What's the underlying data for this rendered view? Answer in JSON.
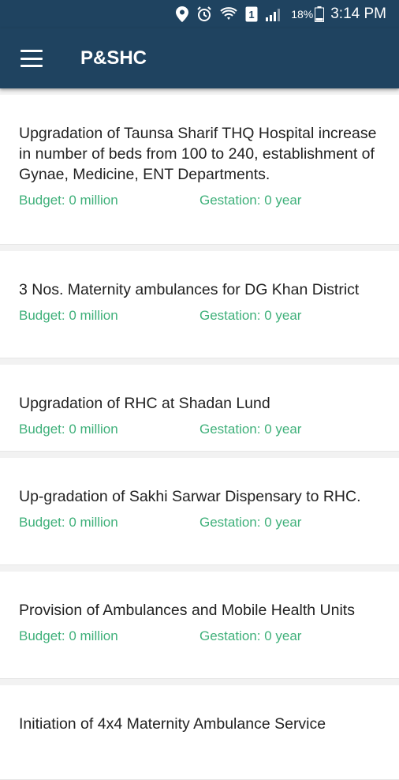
{
  "status_bar": {
    "battery_percent": "18%",
    "time": "3:14 PM",
    "sim_label": "1",
    "icons": [
      "location-icon",
      "alarm-icon",
      "wifi-icon",
      "sim-icon",
      "signal-icon",
      "battery-icon"
    ]
  },
  "app_bar": {
    "title": "P&SHC",
    "menu_icon": "hamburger-menu-icon"
  },
  "projects": [
    {
      "title": "Upgradation of Taunsa Sharif THQ Hospital increase in number of beds from 100 to 240, establishment of Gynae, Medicine, ENT Departments.",
      "budget": "Budget: 0 million",
      "gestation": "Gestation: 0 year"
    },
    {
      "title": "3 Nos. Maternity ambulances for DG Khan District",
      "budget": "Budget: 0 million",
      "gestation": "Gestation: 0 year"
    },
    {
      "title": "Upgradation of RHC at Shadan Lund",
      "budget": "Budget: 0 million",
      "gestation": "Gestation: 0 year"
    },
    {
      "title": "Up-gradation of Sakhi Sarwar Dispensary to RHC.",
      "budget": "Budget: 0 million",
      "gestation": "Gestation: 0 year"
    },
    {
      "title": "Provision of Ambulances and Mobile Health Units",
      "budget": "Budget: 0 million",
      "gestation": "Gestation: 0 year"
    },
    {
      "title": "Initiation of 4x4 Maternity Ambulance Service",
      "budget": "",
      "gestation": ""
    }
  ],
  "colors": {
    "primary": "#1f4360",
    "accent_green": "#3fb07a",
    "background": "#f2f2f2"
  }
}
